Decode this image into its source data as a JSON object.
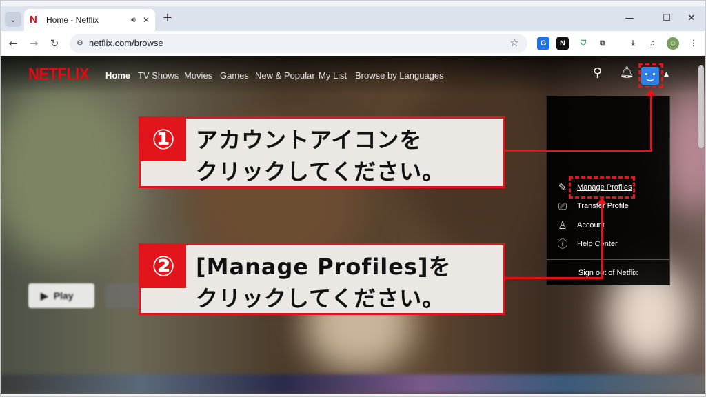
{
  "browser": {
    "tab_title": "Home - Netflix",
    "favicon": "N",
    "url": "netflix.com/browse",
    "icons": {
      "tab_search": "chevron-down-icon",
      "audio": "speaker-icon",
      "close_tab": "close-icon",
      "new_tab": "plus-icon",
      "back": "back-arrow-icon",
      "forward": "forward-arrow-icon",
      "reload": "reload-icon",
      "site_info": "site-settings-icon",
      "bookmark": "star-icon",
      "downloads": "download-icon",
      "media": "media-control-icon"
    }
  },
  "netflix": {
    "logo": "NETFLIX",
    "nav": [
      "Home",
      "TV Shows",
      "Movies",
      "Games",
      "New & Popular",
      "My List",
      "Browse by Languages"
    ],
    "play_label": "Play",
    "dropdown": {
      "items": [
        {
          "label": "Manage Profiles",
          "icon": "pencil-icon"
        },
        {
          "label": "Transfer Profile",
          "icon": "transfer-profile-icon"
        },
        {
          "label": "Account",
          "icon": "person-icon"
        },
        {
          "label": "Help Center",
          "icon": "help-icon"
        }
      ],
      "sign_out": "Sign out of Netflix"
    }
  },
  "annotations": [
    {
      "number": "①",
      "line1": "アカウントアイコンを",
      "line2": "クリックしてください。"
    },
    {
      "number": "②",
      "line1": "[Manage Profiles]を",
      "line2": "クリックしてください。"
    }
  ],
  "colors": {
    "netflix_red": "#e50914",
    "annotation_red": "#e1151b",
    "avatar_blue": "#2e7fe8"
  }
}
